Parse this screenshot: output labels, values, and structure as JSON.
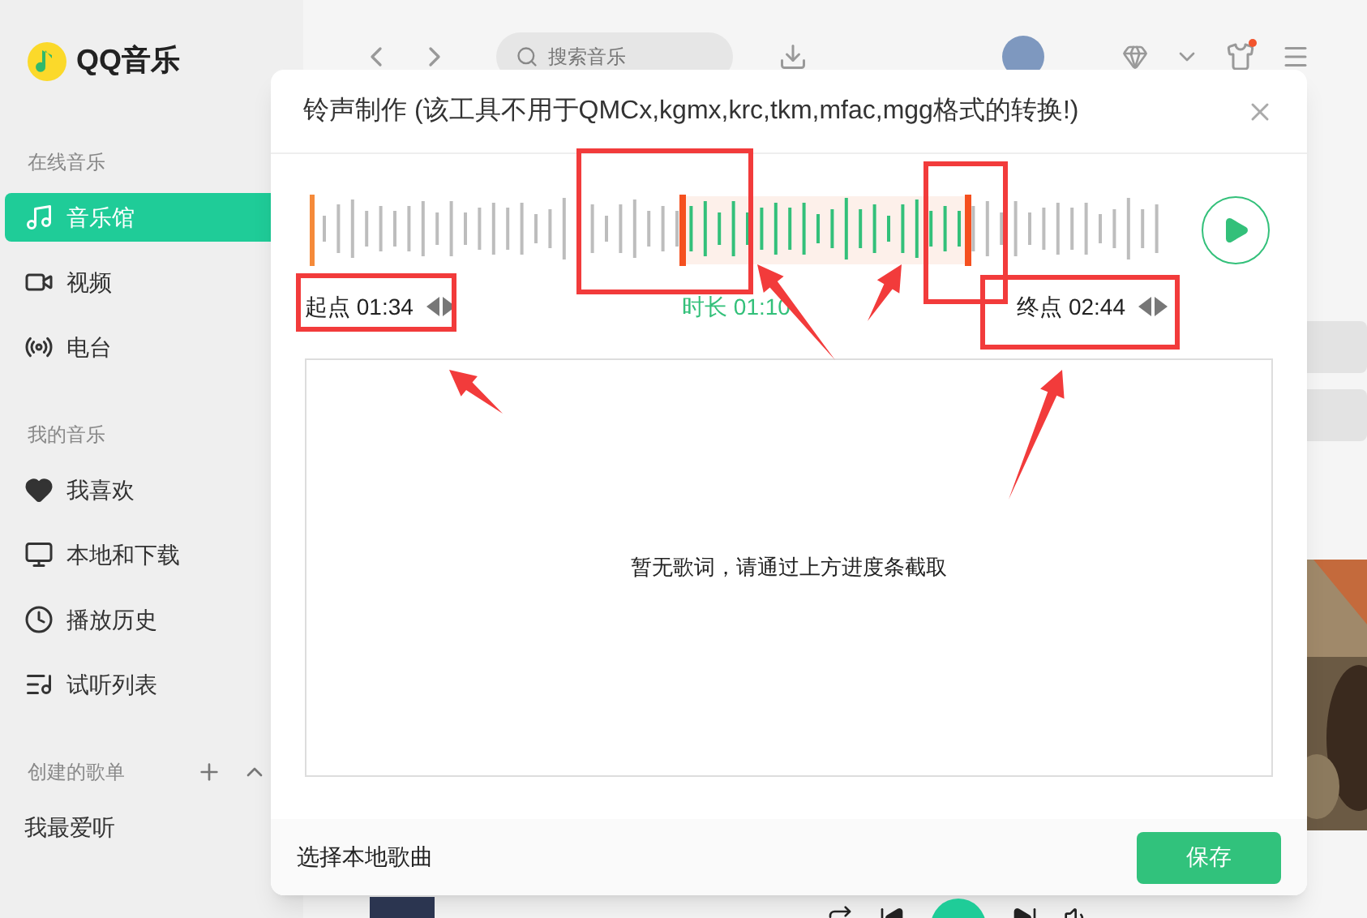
{
  "app": {
    "name": "QQ音乐"
  },
  "sidebar": {
    "sections": [
      {
        "title": "在线音乐",
        "items": [
          {
            "label": "音乐馆",
            "kind": "music",
            "selected": true
          },
          {
            "label": "视频",
            "kind": "video",
            "selected": false
          },
          {
            "label": "电台",
            "kind": "radio",
            "selected": false
          }
        ]
      },
      {
        "title": "我的音乐",
        "items": [
          {
            "label": "我喜欢",
            "kind": "heart",
            "selected": false
          },
          {
            "label": "本地和下载",
            "kind": "monitor",
            "selected": false
          },
          {
            "label": "播放历史",
            "kind": "clock",
            "selected": false
          },
          {
            "label": "试听列表",
            "kind": "playlist",
            "selected": false
          }
        ]
      },
      {
        "title": "创建的歌单",
        "kind": "collapsible",
        "items": [
          {
            "label": "我最爱听",
            "kind": "plain",
            "selected": false
          }
        ]
      }
    ]
  },
  "search": {
    "placeholder": "搜索音乐"
  },
  "dialog": {
    "title": "铃声制作 (该工具不用于QMCx,kgmx,krc,tkm,mfac,mgg格式的转换!)",
    "start": {
      "label": "起点",
      "time": "01:34",
      "level": 0.43
    },
    "end": {
      "label": "终点",
      "time": "02:44",
      "level": 0.76
    },
    "duration": {
      "label": "时长",
      "time": "01:10"
    },
    "lyrics_message": "暂无歌词，请通过上方进度条截取",
    "choose_local": "选择本地歌曲",
    "save": "保存"
  }
}
